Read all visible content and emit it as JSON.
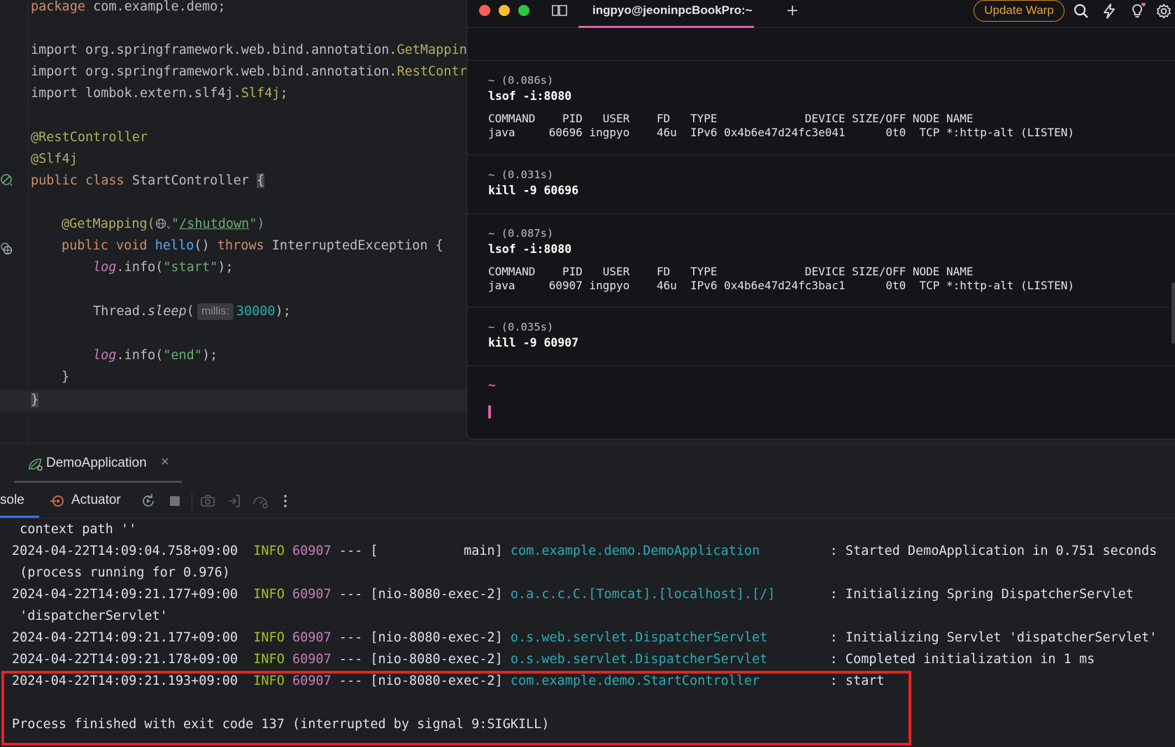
{
  "editor": {
    "lines": {
      "package": "package com.example.demo;",
      "import1_prefix": "import org.springframework.web.bind.annotation.",
      "import1_cls": "GetMappin",
      "import2_prefix": "import org.springframework.web.bind.annotation.",
      "import2_cls": "RestContr",
      "import3_prefix": "import lombok.extern.slf4j.",
      "import3_cls": "Slf4j",
      "import3_suffix": ";",
      "ann_rest": "@RestController",
      "ann_slf4j": "@Slf4j",
      "class_kw": "public class ",
      "class_name": "StartController ",
      "class_brace": "{",
      "getmapping": "@GetMapping(",
      "getmapping_quote_open": "\"",
      "getmapping_path": "/shutdown",
      "getmapping_close": "\")",
      "method_kw": "public void ",
      "method_name": "hello",
      "method_parens": "() ",
      "method_throws": "throws ",
      "method_exc": "InterruptedException {",
      "log_start_obj": "log",
      "log_start_call": ".info(",
      "log_start_str": "\"start\"",
      "log_start_end": ");",
      "sleep_prefix": "Thread.",
      "sleep_fn": "sleep",
      "sleep_paren": "(",
      "sleep_hint": "millis:",
      "sleep_value": "30000",
      "sleep_end": ");",
      "log_end_obj": "log",
      "log_end_call": ".info(",
      "log_end_str": "\"end\"",
      "log_end_end": ");",
      "method_close": "}",
      "class_close": "}"
    }
  },
  "warp": {
    "tab_title": "ingpyo@jeoninpcBookPro:~",
    "update_button": "Update Warp",
    "blocks": [
      {
        "meta": "~ (0.086s)",
        "command": "lsof -i:8080",
        "output": [
          "COMMAND    PID   USER    FD   TYPE             DEVICE SIZE/OFF NODE NAME",
          "java     60696 ingpyo    46u  IPv6 0x4b6e47d24fc3e041      0t0  TCP *:http-alt (LISTEN)"
        ]
      },
      {
        "meta": "~ (0.031s)",
        "command": "kill -9 60696"
      },
      {
        "meta": "~ (0.087s)",
        "command": "lsof -i:8080",
        "output": [
          "COMMAND    PID   USER    FD   TYPE             DEVICE SIZE/OFF NODE NAME",
          "java     60907 ingpyo    46u  IPv6 0x4b6e47d24fc3bac1      0t0  TCP *:http-alt (LISTEN)"
        ]
      },
      {
        "meta": "~ (0.035s)",
        "command": "kill -9 60907"
      }
    ],
    "prompt": "~"
  },
  "run": {
    "tab_label": "DemoApplication",
    "close_glyph": "×",
    "console_tab": "sole",
    "actuator_tab": "Actuator"
  },
  "console": {
    "lines": {
      "l0": " context path ''",
      "l1_ts": "2024-04-22T14:09:04.758+09:00  ",
      "l1_lvl": "INFO",
      "l1_pid": " 60907",
      "l1_thread": " --- [           main] ",
      "l1_logger": "com.example.demo.DemoApplication",
      "l1_msg": "         : Started DemoApplication in 0.751 seconds",
      "l2": " (process running for 0.976)",
      "l3_ts": "2024-04-22T14:09:21.177+09:00  ",
      "l3_lvl": "INFO",
      "l3_pid": " 60907",
      "l3_thread": " --- [nio-8080-exec-2] ",
      "l3_logger": "o.a.c.c.C.[Tomcat].[localhost].[/]",
      "l3_msg": "       : Initializing Spring DispatcherServlet",
      "l4": " 'dispatcherServlet'",
      "l5_ts": "2024-04-22T14:09:21.177+09:00  ",
      "l5_lvl": "INFO",
      "l5_pid": " 60907",
      "l5_thread": " --- [nio-8080-exec-2] ",
      "l5_logger": "o.s.web.servlet.DispatcherServlet",
      "l5_msg": "        : Initializing Servlet 'dispatcherServlet'",
      "l6_ts": "2024-04-22T14:09:21.178+09:00  ",
      "l6_lvl": "INFO",
      "l6_pid": " 60907",
      "l6_thread": " --- [nio-8080-exec-2] ",
      "l6_logger": "o.s.web.servlet.DispatcherServlet",
      "l6_msg": "        : Completed initialization in 1 ms",
      "l7_ts": "2024-04-22T14:09:21.193+09:00  ",
      "l7_lvl": "INFO",
      "l7_pid": " 60907",
      "l7_thread": " --- [nio-8080-exec-2] ",
      "l7_logger": "com.example.demo.StartController",
      "l7_msg": "         : start",
      "l8": "Process finished with exit code 137 (interrupted by signal 9:SIGKILL)"
    }
  },
  "colors": {
    "highlight_box": "#e8241f",
    "warp_accent": "#e05fa8",
    "update_warp": "#e8a23a"
  }
}
